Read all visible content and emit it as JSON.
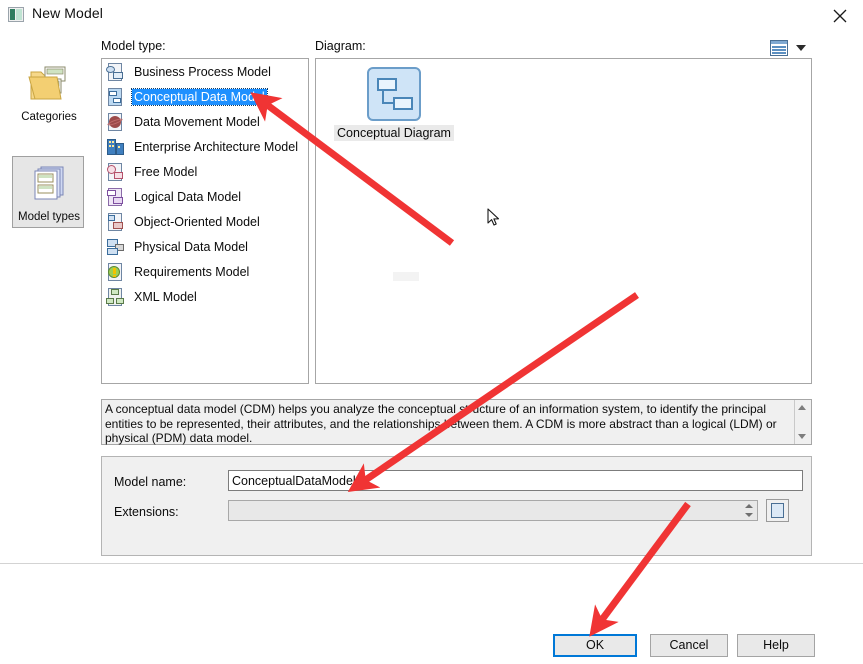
{
  "window": {
    "title": "New Model",
    "icon": "app-window-icon",
    "close_icon": "close-icon"
  },
  "left_rail": {
    "items": [
      {
        "label": "Categories",
        "icon": "folder-categories-icon",
        "selected": false
      },
      {
        "label": "Model types",
        "icon": "stacked-models-icon",
        "selected": true
      }
    ]
  },
  "labels": {
    "model_type": "Model type:",
    "diagram": "Diagram:"
  },
  "view_mode": {
    "icon": "list-view-icon",
    "caret_icon": "chevron-down-icon"
  },
  "model_types": {
    "items": [
      {
        "label": "Business Process Model",
        "icon": "business-process-model-icon",
        "selected": false
      },
      {
        "label": "Conceptual Data Model",
        "icon": "conceptual-data-model-icon",
        "selected": true
      },
      {
        "label": "Data Movement Model",
        "icon": "data-movement-model-icon",
        "selected": false
      },
      {
        "label": "Enterprise Architecture Model",
        "icon": "enterprise-architecture-model-icon",
        "selected": false
      },
      {
        "label": "Free Model",
        "icon": "free-model-icon",
        "selected": false
      },
      {
        "label": "Logical Data Model",
        "icon": "logical-data-model-icon",
        "selected": false
      },
      {
        "label": "Object-Oriented Model",
        "icon": "object-oriented-model-icon",
        "selected": false
      },
      {
        "label": "Physical Data Model",
        "icon": "physical-data-model-icon",
        "selected": false
      },
      {
        "label": "Requirements Model",
        "icon": "requirements-model-icon",
        "selected": false
      },
      {
        "label": "XML Model",
        "icon": "xml-model-icon",
        "selected": false
      }
    ]
  },
  "diagram": {
    "items": [
      {
        "label": "Conceptual Diagram",
        "icon": "conceptual-diagram-thumbnail",
        "selected": true
      }
    ]
  },
  "description": {
    "text": "A conceptual data model (CDM) helps you analyze the conceptual structure of an information system, to identify the principal entities to be represented, their attributes, and the relationships between them. A CDM is more abstract than a logical (LDM) or physical (PDM) data model.",
    "scroll_up_icon": "scroll-up-arrow-icon",
    "scroll_down_icon": "scroll-down-arrow-icon"
  },
  "form": {
    "model_name_label": "Model name:",
    "model_name_value": "ConceptualDataModel_1",
    "model_name_placeholder": "",
    "extensions_label": "Extensions:",
    "extensions_value": "",
    "extensions_placeholder": "",
    "extensions_browse_icon": "browse-extensions-icon",
    "extensions_spinner_icon": "spinner-icon"
  },
  "buttons": {
    "ok": "OK",
    "cancel": "Cancel",
    "help": "Help"
  },
  "colors": {
    "selection_blue": "#1e90ff",
    "focus_blue": "#0078d7",
    "annotation_red": "#f03434",
    "dialog_background": "#ffffff",
    "panel_grey": "#f0f0f0"
  },
  "annotations": {
    "arrows": [
      {
        "name": "arrow-to-conceptual-data-model",
        "points_to": "Conceptual Data Model list item"
      },
      {
        "name": "arrow-to-model-name-field",
        "points_to": "Model name input"
      },
      {
        "name": "arrow-to-ok-button",
        "points_to": "OK button"
      }
    ]
  },
  "cursor": {
    "icon": "mouse-pointer-icon"
  }
}
